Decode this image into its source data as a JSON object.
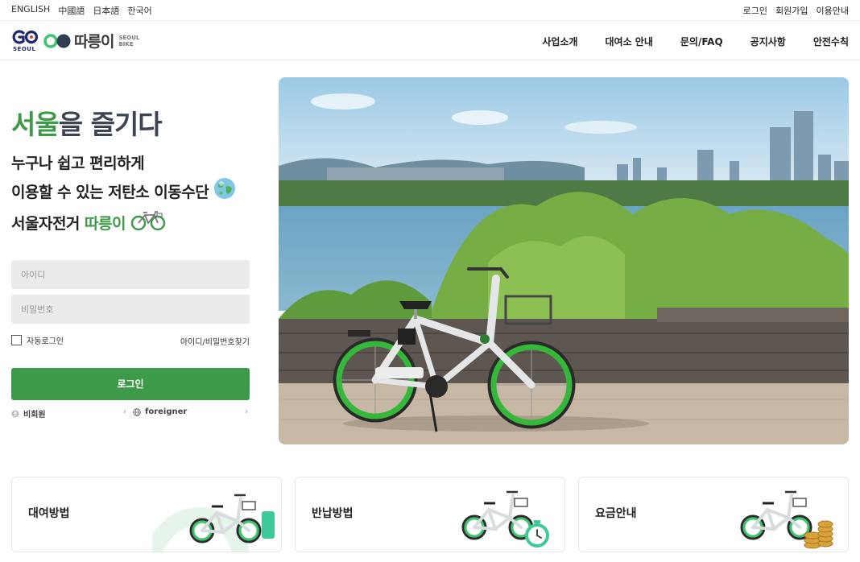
{
  "topbar": {
    "languages": [
      "ENGLISH",
      "中國語",
      "日本語",
      "한국어"
    ],
    "account_links": [
      "로그인",
      "회원가입",
      "이용안내"
    ]
  },
  "header": {
    "brand_seoul": "SEOUL",
    "brand_name": "따릉이",
    "brand_sub_line1": "SEOUL",
    "brand_sub_line2": "BIKE",
    "nav": [
      "사업소개",
      "대여소 안내",
      "문의/FAQ",
      "공지사항",
      "안전수칙"
    ]
  },
  "hero": {
    "title_accent": "서울",
    "title_rest": "을 즐기다",
    "desc_line1": "누구나 쉽고 편리하게",
    "desc_line2": "이용할 수 있는 저탄소 이동수단",
    "desc_line3_prefix": "서울자전거 ",
    "desc_line3_brand": "따릉이"
  },
  "login": {
    "id_placeholder": "아이디",
    "pw_placeholder": "비밀번호",
    "auto_login_label": "자동로그인",
    "auto_login_checked": false,
    "find_link": "아이디/비밀번호찾기",
    "login_button": "로그인",
    "guest_link": "비회원",
    "foreigner_link": "foreigner",
    "chevron": "›"
  },
  "cards": [
    {
      "label": "대여방법",
      "icon": "bike-with-phone-icon"
    },
    {
      "label": "반납방법",
      "icon": "bike-with-clock-icon"
    },
    {
      "label": "요금안내",
      "icon": "bike-with-coins-icon"
    }
  ],
  "colors": {
    "brand_green": "#3c9a48",
    "title_gray": "#3d4451",
    "field_bg": "#ebebeb"
  }
}
